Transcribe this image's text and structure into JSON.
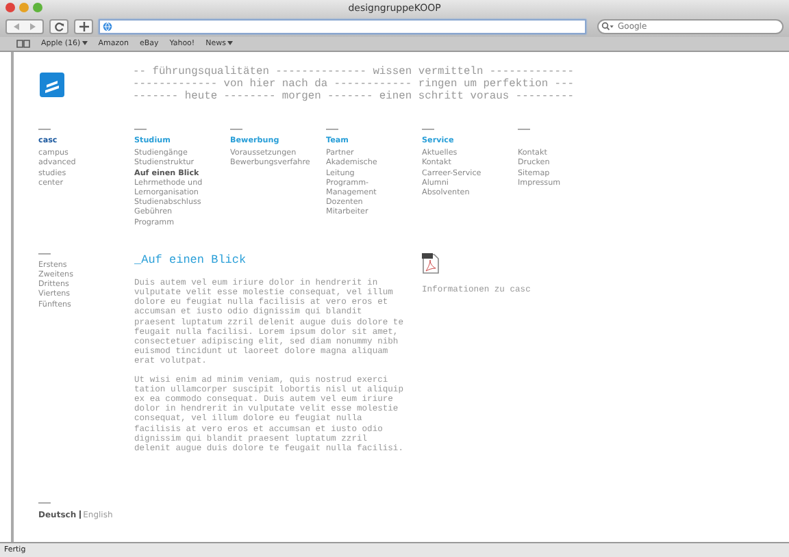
{
  "window": {
    "title": "designgruppeKOOP"
  },
  "search": {
    "placeholder": "Google"
  },
  "bookmarks": [
    {
      "label": "Apple (16)",
      "menu": true
    },
    {
      "label": "Amazon",
      "menu": false
    },
    {
      "label": "eBay",
      "menu": false
    },
    {
      "label": "Yahoo!",
      "menu": false
    },
    {
      "label": "News",
      "menu": true
    }
  ],
  "motto": [
    "-- führungsqualitäten -------------- wissen vermitteln -------------",
    "------------- von hier nach da ------------ ringen um perfektion ---",
    "------- heute -------- morgen ------- einen schritt voraus ---------"
  ],
  "nav": [
    {
      "heading": "casc",
      "items": [
        {
          "label": "campus",
          "selected": false
        },
        {
          "label": "advanced",
          "selected": false
        },
        {
          "label": "studies",
          "selected": false
        },
        {
          "label": "center",
          "selected": false
        }
      ]
    },
    {
      "heading": "Studium",
      "items": [
        {
          "label": "Studiengänge",
          "selected": false
        },
        {
          "label": "Studienstruktur",
          "selected": false
        },
        {
          "label": "Auf einen Blick",
          "selected": true
        },
        {
          "label": "Lehrmethode und Lernorganisation",
          "selected": false
        },
        {
          "label": "Studienabschluss",
          "selected": false
        },
        {
          "label": "Gebühren",
          "selected": false
        },
        {
          "label": "Programm",
          "selected": false
        }
      ]
    },
    {
      "heading": "Bewerbung",
      "items": [
        {
          "label": "Voraussetzungen",
          "selected": false
        },
        {
          "label": "Bewerbungsverfahre",
          "selected": false
        }
      ]
    },
    {
      "heading": "Team",
      "items": [
        {
          "label": "Partner",
          "selected": false
        },
        {
          "label": "Akademische",
          "selected": false
        },
        {
          "label": "Leitung",
          "selected": false
        },
        {
          "label": "Programm-",
          "selected": false
        },
        {
          "label": "Management",
          "selected": false
        },
        {
          "label": "Dozenten",
          "selected": false
        },
        {
          "label": "Mitarbeiter",
          "selected": false
        }
      ]
    },
    {
      "heading": "Service",
      "items": [
        {
          "label": "Aktuelles",
          "selected": false
        },
        {
          "label": "Kontakt",
          "selected": false
        },
        {
          "label": "Carreer-Service",
          "selected": false
        },
        {
          "label": "Alumni",
          "selected": false
        },
        {
          "label": "Absolventen",
          "selected": false
        }
      ]
    },
    {
      "items": [
        {
          "label": "Kontakt",
          "selected": false
        },
        {
          "label": "Drucken",
          "selected": false
        },
        {
          "label": "Sitemap",
          "selected": false
        },
        {
          "label": "Impressum",
          "selected": false
        }
      ]
    }
  ],
  "subnav": [
    "Erstens",
    "Zweitens",
    "Drittens",
    "Viertens",
    "Fünftens"
  ],
  "languages": [
    {
      "label": "Deutsch",
      "selected": true
    },
    {
      "label": "English",
      "selected": false
    }
  ],
  "article": {
    "title": "_Auf einen Blick",
    "paragraphs": [
      "Duis autem vel eum iriure dolor in hendrerit in vulputate velit esse molestie consequat, vel illum dolore eu feugiat nulla facilisis at vero eros et accumsan et iusto odio dignissim qui blandit praesent luptatum zzril delenit augue duis dolore te feugait nulla facilisi. Lorem ipsum dolor sit amet, consectetuer adipiscing elit, sed diam nonummy nibh euismod tincidunt ut laoreet dolore magna aliquam erat volutpat.",
      "Ut wisi enim ad minim veniam, quis nostrud exerci tation ullamcorper suscipit lobortis nisl ut aliquip ex ea commodo consequat. Duis autem vel eum iriure dolor in hendrerit in vulputate velit esse molestie consequat, vel illum dolore eu feugiat nulla facilisis at vero eros et accumsan et iusto odio dignissim qui blandit praesent luptatum zzril delenit augue duis dolore te feugait nulla facilisi."
    ]
  },
  "download": {
    "label": "Informationen zu casc"
  },
  "status_bar": "Fertig"
}
